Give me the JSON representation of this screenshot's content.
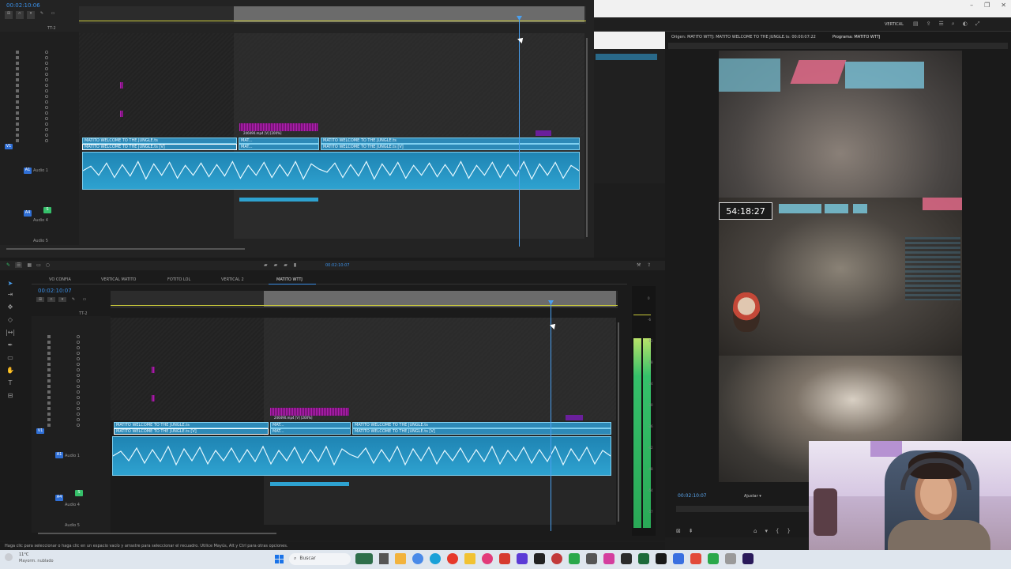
{
  "top_timeline": {
    "timecode": "00:02:10:06",
    "tracks_label": "TT-2",
    "audio_track_1_name": "Audio 1",
    "audio_track_4_name": "Audio 4",
    "audio_track_5_name": "Audio 5",
    "video_clip_1_label": "MATITO WELCOME TO THE JUNGLE.ts",
    "video_clip_2_label": "MATITO WELCOME TO THE JUNGLE.ts [V]",
    "nested_clip_label": "246490.mp4 [V] [200%]",
    "short_clip_label": "MAT...",
    "right_clip_label": "MATITO WELCOME TO THE JUNGLE.ts",
    "right_clip_v_label": "MATITO WELCOME TO THE JUNGLE.ts [V]"
  },
  "right_panel": {
    "workspace_label": "VERTICAL",
    "origin_label": "Origen: MATITO WTTJ: MATITO WELCOME TO THE JUNGLE.ts: 00:00:07:22",
    "program_label": "Programa: MATITO WTTJ",
    "overlay_timer": "54:18:27",
    "program_timecode": "00:02:10:07",
    "fit_label": "Ajustar"
  },
  "bottom_timeline": {
    "tabs": [
      {
        "label": "VO CONFIA"
      },
      {
        "label": "VERTICAL MATITO"
      },
      {
        "label": "FOTITO LOL"
      },
      {
        "label": "VERTICAL 2"
      },
      {
        "label": "MATITO WTTJ"
      }
    ],
    "active_tab": "MATITO WTTJ",
    "timecode": "00:02:10:07",
    "small_timecode": "00:02:10:07",
    "tracks_label": "TT-2",
    "audio_track_1_name": "Audio 1",
    "audio_track_4_name": "Audio 4",
    "audio_track_5_name": "Audio 5",
    "video_clip_1_label": "MATITO WELCOME TO THE JUNGLE.ts",
    "video_clip_2_label": "MATITO WELCOME TO THE JUNGLE.ts [V]",
    "nested_clip_label": "246490.mp4 [V] [200%]",
    "short_clip_label": "MAT...",
    "right_clip_label": "MATITO WELCOME TO THE JUNGLE.ts",
    "right_clip_v_label": "MATITO WELCOME TO THE JUNGLE.ts [V]"
  },
  "meter_ticks": [
    "0",
    "-6",
    "-12",
    "-18",
    "-24",
    "-30",
    "-36",
    "-42",
    "-48",
    "-54",
    "-57"
  ],
  "status_bar": "Haga clic para seleccionar o haga clic en un espacio vacío y arrastre para seleccionar el recuadro. Utilice Mayús, Alt y Ctrl para otras opciones.",
  "taskbar": {
    "weather_temp": "11°C",
    "weather_desc": "Mayorm. nublado",
    "search_placeholder": "Buscar"
  },
  "colors": {
    "accent_blue": "#2d89b7",
    "playhead": "#4aa0f0",
    "magenta": "#b020b0",
    "meter_green": "#35c06a"
  }
}
